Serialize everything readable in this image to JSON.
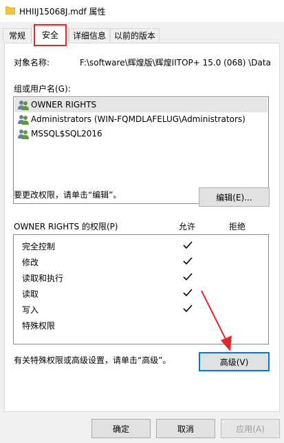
{
  "window": {
    "title": "HHIIJ15068J.mdf 属性"
  },
  "tabs": [
    {
      "label": "常规"
    },
    {
      "label": "安全"
    },
    {
      "label": "详细信息"
    },
    {
      "label": "以前的版本"
    }
  ],
  "security": {
    "object_name_label": "对象名称:",
    "object_name_value": "F:\\software\\辉煌版\\辉煌IITOP+ 15.0 (068) \\Data",
    "group_label": "组或用户名(G):",
    "users": [
      {
        "name": "OWNER RIGHTS",
        "selected": true
      },
      {
        "name": "Administrators (WIN-FQMDLAFELUG\\Administrators)"
      },
      {
        "name": "MSSQL$SQL2016"
      }
    ],
    "edit_hint": "要更改权限，请单击“编辑”。",
    "edit_button": "编辑(E)...",
    "perm_header": "OWNER RIGHTS 的权限(P)",
    "allow_label": "允许",
    "deny_label": "拒绝",
    "permissions": [
      {
        "name": "完全控制",
        "allow": true,
        "deny": false
      },
      {
        "name": "修改",
        "allow": true,
        "deny": false
      },
      {
        "name": "读取和执行",
        "allow": true,
        "deny": false
      },
      {
        "name": "读取",
        "allow": true,
        "deny": false
      },
      {
        "name": "写入",
        "allow": true,
        "deny": false
      },
      {
        "name": "特殊权限",
        "allow": false,
        "deny": false
      }
    ],
    "advanced_hint": "有关特殊权限或高级设置，请单击“高级”。",
    "advanced_button": "高级(V)"
  },
  "footer": {
    "ok": "确定",
    "cancel": "取消",
    "apply": "应用(A)"
  },
  "colors": {
    "highlight": "#e0282e",
    "focus_border": "#0078d7"
  }
}
